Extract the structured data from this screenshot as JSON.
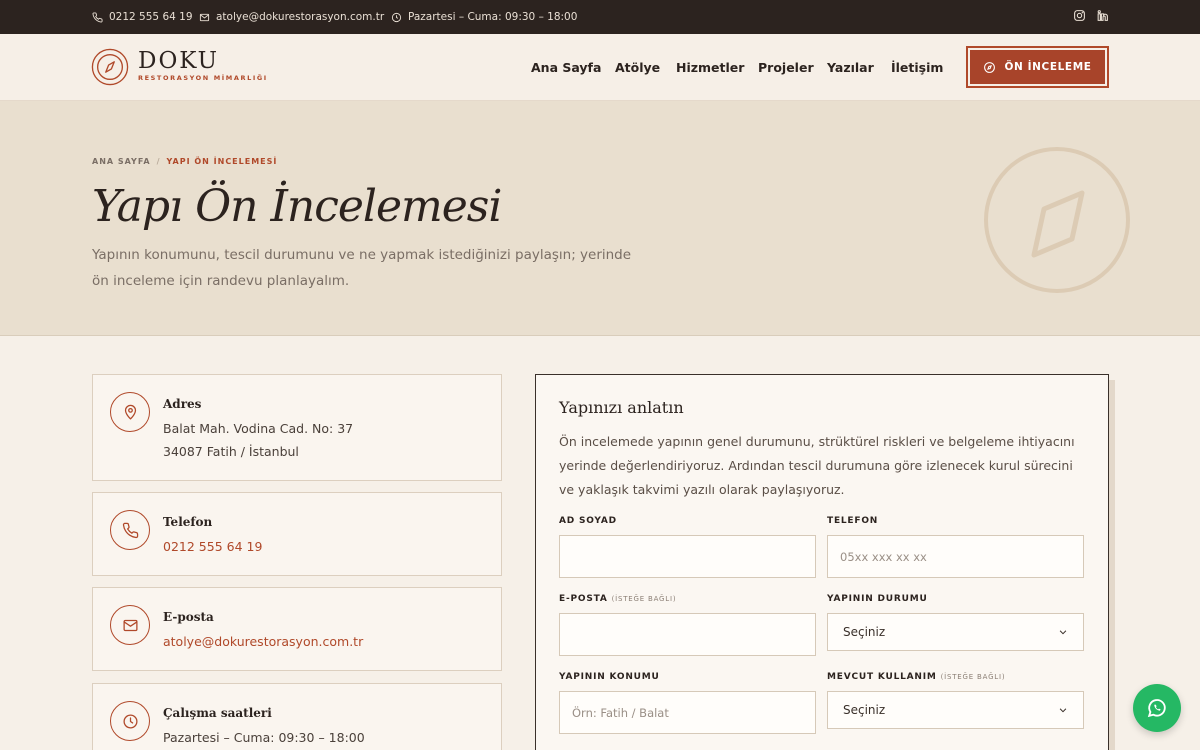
{
  "topbar": {
    "phone": "0212 555 64 19",
    "email": "atolye@dokurestorasyon.com.tr",
    "hours": "Pazartesi – Cuma: 09:30 – 18:00",
    "social": [
      "instagram-icon",
      "linkedin-icon"
    ]
  },
  "brand": {
    "name": "DOKU",
    "tagline": "RESTORASYON MİMARLIĞI",
    "accent": "#b0492a"
  },
  "nav": {
    "items": [
      "Ana Sayfa",
      "Atölye",
      "Hizmetler",
      "Projeler",
      "Yazılar",
      "İletişim"
    ],
    "cta": "ÖN İNCELEME"
  },
  "hero": {
    "breadcrumb": {
      "home": "ANA SAYFA",
      "separator": "/",
      "current": "YAPI ÖN İNCELEMESİ"
    },
    "title": "Yapı Ön İncelemesi",
    "description_line1": "Yapının konumunu, tescil durumunu ve ne yapmak istediğinizi paylaşın; yerinde",
    "description_line2": "ön inceleme için randevu planlayalım."
  },
  "contact": {
    "address": {
      "title": "Adres",
      "line1": "Balat Mah. Vodina Cad. No: 37",
      "line2": "34087 Fatih / İstanbul"
    },
    "phone": {
      "title": "Telefon",
      "value": "0212 555 64 19"
    },
    "email": {
      "title": "E-posta",
      "value": "atolye@dokurestorasyon.com.tr"
    },
    "hours": {
      "title": "Çalışma saatleri",
      "value": "Pazartesi – Cuma: 09:30 – 18:00"
    }
  },
  "form": {
    "title": "Yapınızı anlatın",
    "desc_line1": "Ön incelemede yapının genel durumunu, strüktürel riskleri ve belgeleme ihtiyacını",
    "desc_line2": "yerinde değerlendiriyoruz. Ardından tescil durumuna göre izlenecek kurul sürecini",
    "desc_line3": "ve yaklaşık takvimi yazılı olarak paylaşıyoruz.",
    "name_label": "AD SOYAD",
    "name_value": "",
    "phone_label": "TELEFON",
    "phone_placeholder": "05xx xxx xx xx",
    "email_label": "E-POSTA",
    "email_optional": "(İSTEĞE BAĞLI)",
    "email_value": "",
    "status_label": "YAPININ DURUMU",
    "status_value": "Seçiniz",
    "location_label": "YAPININ KONUMU",
    "location_placeholder": "Örn: Fatih / Balat",
    "usage_label": "MEVCUT KULLANIM",
    "usage_optional": "(İSTEĞE BAĞLI)",
    "usage_value": "Seçiniz"
  },
  "whatsapp": {
    "icon": "whatsapp-icon",
    "color": "#25b864"
  }
}
